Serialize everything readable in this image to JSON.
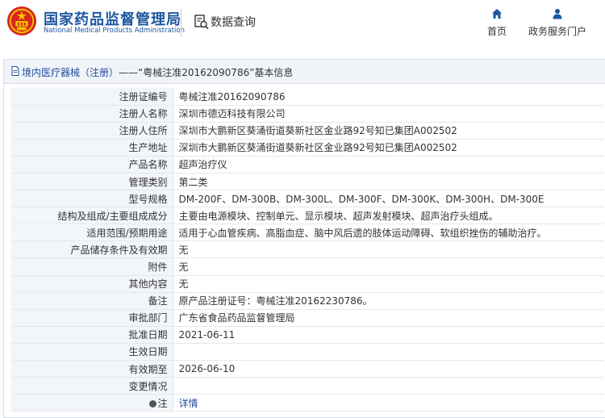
{
  "header": {
    "logo_title": "国家药品监督管理局",
    "logo_subtitle": "National Medical Products Administration",
    "search_title": "数据查询",
    "nav": {
      "home_label": "首页",
      "services_label": "政务服务门户"
    }
  },
  "colors": {
    "brand_blue": "#1e56a0",
    "link_blue": "#1f4e9c",
    "label_bg": "#f2f5f9",
    "header_bg": "#f0f3f7",
    "emblem_red": "#d7261e",
    "emblem_gold": "#f2c200"
  },
  "panel": {
    "breadcrumb_link": "境内医疗器械（注册）",
    "breadcrumb_rest": "——“粤械注准20162090786”基本信息"
  },
  "rows": [
    {
      "label": "注册证编号",
      "value": "粤械注准20162090786"
    },
    {
      "label": "注册人名称",
      "value": "深圳市德迈科技有限公司"
    },
    {
      "label": "注册人住所",
      "value": "深圳市大鹏新区葵涌街道葵新社区金业路92号知已集团A002502"
    },
    {
      "label": "生产地址",
      "value": "深圳市大鹏新区葵涌街道葵新社区金业路92号知已集团A002502"
    },
    {
      "label": "产品名称",
      "value": "超声治疗仪"
    },
    {
      "label": "管理类别",
      "value": "第二类"
    },
    {
      "label": "型号规格",
      "value": "DM-200F、DM-300B、DM-300L、DM-300F、DM-300K、DM-300H、DM-300E"
    },
    {
      "label": "结构及组成/主要组成成分",
      "value": "主要由电源模块、控制单元、显示模块、超声发射模块、超声治疗头组成。"
    },
    {
      "label": "适用范围/预期用途",
      "value": "适用于心血管疾病、高脂血症、脑中风后遗的肢体运动障碍、软组织挫伤的辅助治疗。"
    },
    {
      "label": "产品储存条件及有效期",
      "value": "无"
    },
    {
      "label": "附件",
      "value": "无"
    },
    {
      "label": "其他内容",
      "value": "无"
    },
    {
      "label": "备注",
      "value": "原产品注册证号：粤械注准20162230786。"
    },
    {
      "label": "审批部门",
      "value": "广东省食品药品监督管理局"
    },
    {
      "label": "批准日期",
      "value": "2021-06-11"
    },
    {
      "label": "生效日期",
      "value": ""
    },
    {
      "label": "有效期至",
      "value": "2026-06-10"
    },
    {
      "label": "变更情况",
      "value": ""
    }
  ],
  "note_row": {
    "label": "注",
    "value": "详情",
    "icon": "bulb-icon"
  },
  "icons": [
    "national-emblem-icon",
    "search-doc-icon",
    "home-icon",
    "person-icon",
    "document-icon",
    "bulb-icon"
  ]
}
